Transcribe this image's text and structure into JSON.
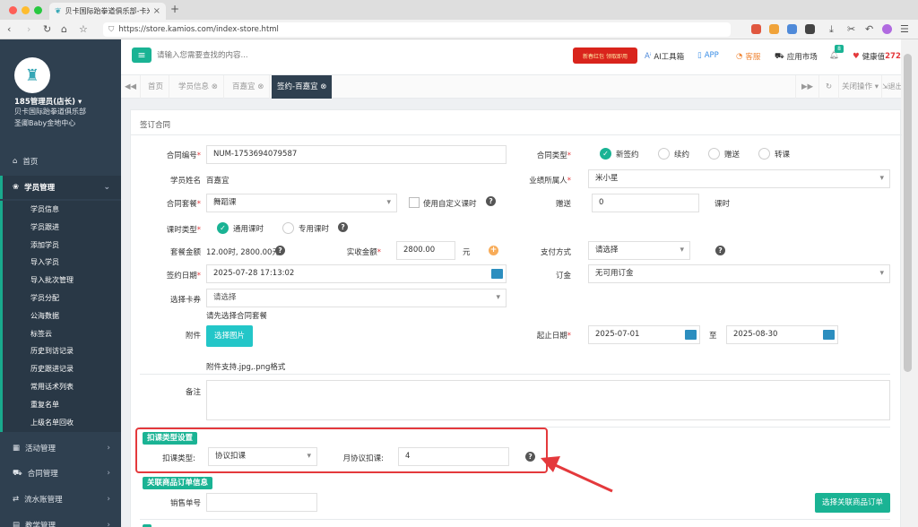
{
  "browser": {
    "tab_title": "贝卡国际跆拳道俱乐部-卡米...",
    "url": "https://store.kamios.com/index-store.html"
  },
  "sidebar": {
    "user": "185管理员(店长) ▾",
    "org": "贝卡国际跆拳道俱乐部",
    "branch": "圣卿Baby金地中心",
    "home": "首页",
    "student_mgmt": "学员管理",
    "sub_items": [
      "学员信息",
      "学员跟进",
      "添加学员",
      "导入学员",
      "导入批次管理",
      "学员分配",
      "公海数据",
      "标签云",
      "历史到访记录",
      "历史跟进记录",
      "常用话术列表",
      "重复名单",
      "上级名单回收"
    ],
    "activity": "活动管理",
    "contract": "合同管理",
    "ledger": "流水账管理",
    "teaching": "教学管理"
  },
  "header": {
    "search_placeholder": "请输入您需要查找的内容...",
    "banner": "新春红包 领取即用",
    "ai_tools": "AI工具箱",
    "app": "APP",
    "service": "客服",
    "market": "应用市场",
    "notif_count": "8",
    "health": "健康值",
    "health_value": "272"
  },
  "tabs": {
    "home": "首页",
    "student_info": "学员信息",
    "student_name_tab": "百嘉宜",
    "contract_tab": "签约-百嘉宜",
    "close_ops": "关闭操作",
    "logout": "退出"
  },
  "form": {
    "panel_title": "签订合同",
    "contract_no_label": "合同编号",
    "contract_no": "NUM-1753694079587",
    "contract_type_label": "合同类型",
    "contract_types": [
      "新签约",
      "续约",
      "赠送",
      "转课"
    ],
    "student_name_label": "学员姓名",
    "student_name": "百嘉宜",
    "owner_label": "业绩所属人",
    "owner": "米小星",
    "package_label": "合同套餐",
    "package": "舞蹈课",
    "custom_hours": "使用自定义课时",
    "gift_label": "赠送",
    "gift_value": "0",
    "gift_unit": "课时",
    "hour_type_label": "课时类型",
    "hour_types": [
      "通用课时",
      "专用课时"
    ],
    "package_amount_label": "套餐金额",
    "package_amount": "12.00时, 2800.00元",
    "actual_amount_label": "实收金额",
    "actual_amount": "2800.00",
    "yuan": "元",
    "pay_method_label": "支付方式",
    "pay_method": "请选择",
    "sign_date_label": "签约日期",
    "sign_date": "2025-07-28 17:13:02",
    "deposit_label": "订金",
    "deposit": "无可用订金",
    "card_label": "选择卡券",
    "card_placeholder": "请选择",
    "card_hint": "请先选择合同套餐",
    "attach_label": "附件",
    "attach_button": "选择图片",
    "attach_hint": "附件支持.jpg,.png格式",
    "period_label": "起止日期",
    "start_date": "2025-07-01",
    "to": "至",
    "end_date": "2025-08-30",
    "remark_label": "备注",
    "deduct_section": "扣课类型设置",
    "deduct_type_label": "扣课类型:",
    "deduct_type": "协议扣课",
    "monthly_label": "月协议扣课:",
    "monthly_value": "4",
    "order_section": "关联商品订单信息",
    "sales_no_label": "销售单号",
    "link_order_button": "选择关联商品订单"
  }
}
